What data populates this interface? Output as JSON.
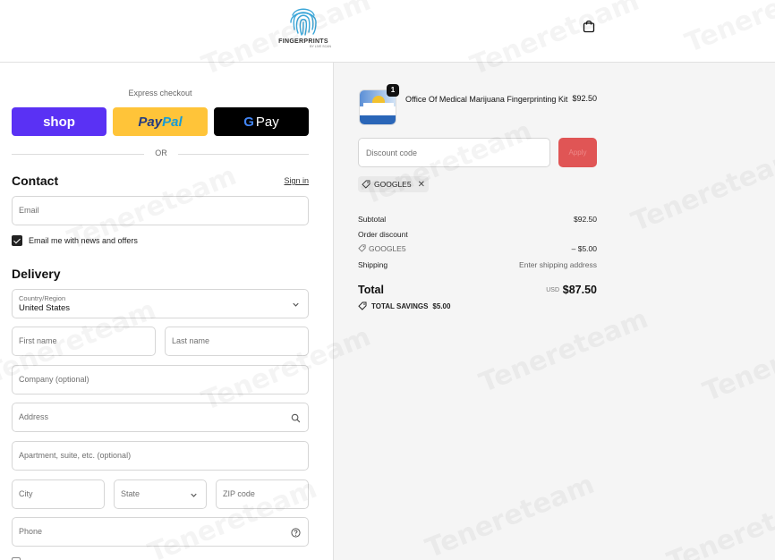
{
  "header": {
    "logo": {
      "brand": "FINGERPRINTS",
      "tagline": "BY LIVE SCAN",
      "icon": "fingerprint-logo"
    },
    "cart_icon": "shopping-bag-icon"
  },
  "checkout": {
    "express_title": "Express checkout",
    "express_buttons": {
      "shop": "shop",
      "paypal_a": "Pay",
      "paypal_b": "Pal",
      "gpay_g": "G",
      "gpay_text": "Pay"
    },
    "or_label": "OR",
    "contact": {
      "title": "Contact",
      "sign_in": "Sign in",
      "email_placeholder": "Email",
      "newsletter_label": "Email me with news and offers",
      "newsletter_checked": true
    },
    "delivery": {
      "title": "Delivery",
      "country_label": "Country/Region",
      "country_value": "United States",
      "first_name": "First name",
      "last_name": "Last name",
      "company": "Company (optional)",
      "address": "Address",
      "apartment": "Apartment, suite, etc. (optional)",
      "city": "City",
      "state": "State",
      "zip": "ZIP code",
      "phone": "Phone"
    }
  },
  "summary": {
    "product": {
      "name": "Office Of Medical Marijuana Fingerprinting Kit",
      "price": "$92.50",
      "quantity": "1"
    },
    "discount_placeholder": "Discount code",
    "apply_label": "Apply",
    "applied_code": "GOOGLE5",
    "subtotal_label": "Subtotal",
    "subtotal_value": "$92.50",
    "order_discount_label": "Order discount",
    "discount_code": "GOOGLE5",
    "discount_value": "– $5.00",
    "shipping_label": "Shipping",
    "shipping_value": "Enter shipping address",
    "total_label": "Total",
    "currency": "USD",
    "total_value": "$87.50",
    "savings_label": "TOTAL SAVINGS",
    "savings_value": "$5.00"
  },
  "watermark": "Tenereteam",
  "colors": {
    "shop": "#5a31f4",
    "paypal": "#ffc439",
    "gpay": "#000000",
    "apply": "#e05555",
    "summary_bg": "#f5f5f5"
  }
}
